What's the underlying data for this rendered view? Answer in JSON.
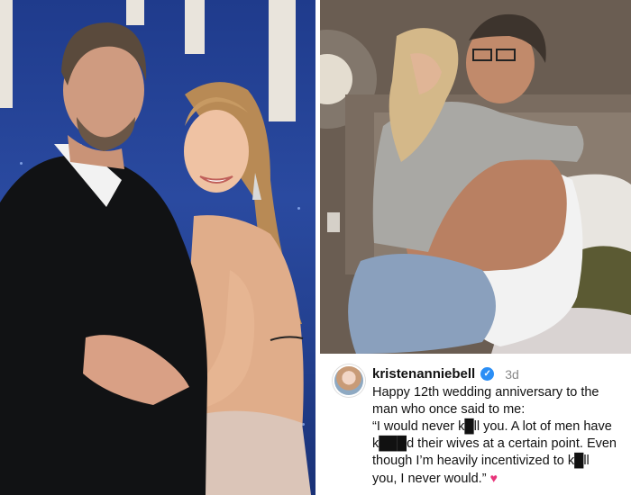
{
  "caption": {
    "username": "kristenanniebell",
    "verified_icon": "verified-badge-icon",
    "age": "3d",
    "lines": [
      "Happy 12th wedding anniversary to the",
      "man who once said to me:",
      "“I would never k█ll you. A lot of men have",
      "k███d their wives at a certain point. Even",
      "though I’m heavily incentivized to k█ll",
      "you, I never would.”"
    ],
    "heart_icon": "heart-icon",
    "colors": {
      "username": "#111111",
      "age": "#888888",
      "verified": "#2b8ef5",
      "heart": "#e8347a"
    }
  }
}
